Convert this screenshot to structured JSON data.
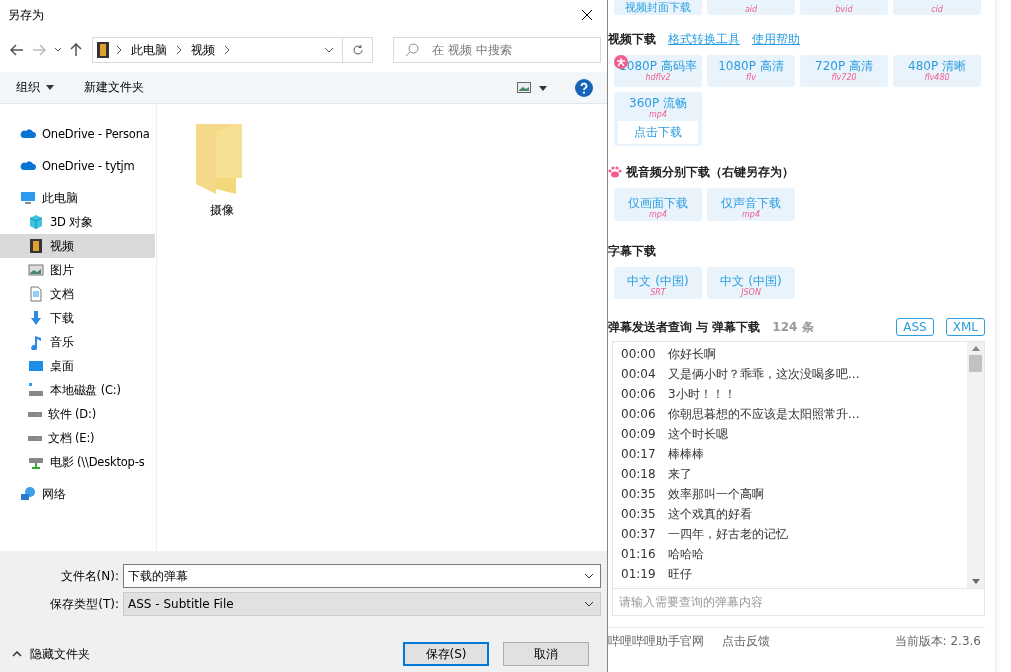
{
  "dialog": {
    "title": "另存为",
    "address": {
      "crumbs": [
        "此电脑",
        "视频"
      ]
    },
    "search": {
      "placeholder": "在 视频 中搜索"
    },
    "toolbar": {
      "organize": "组织",
      "new_folder": "新建文件夹"
    },
    "nav": [
      {
        "label": "OneDrive - Persona",
        "kind": "cloud",
        "selected": false
      },
      {
        "label": "OneDrive - tytjm",
        "kind": "cloud",
        "selected": false
      },
      {
        "label": "此电脑",
        "kind": "pc",
        "selected": false,
        "children": [
          {
            "label": "3D 对象",
            "kind": "cube",
            "selected": false
          },
          {
            "label": "视频",
            "kind": "film",
            "selected": true
          },
          {
            "label": "图片",
            "kind": "picture",
            "selected": false
          },
          {
            "label": "文档",
            "kind": "doc",
            "selected": false
          },
          {
            "label": "下载",
            "kind": "download",
            "selected": false
          },
          {
            "label": "音乐",
            "kind": "music",
            "selected": false
          },
          {
            "label": "桌面",
            "kind": "desktop",
            "selected": false
          },
          {
            "label": "本地磁盘 (C:)",
            "kind": "sysdrive",
            "selected": false
          },
          {
            "label": "软件 (D:)",
            "kind": "drive",
            "selected": false
          },
          {
            "label": "文档 (E:)",
            "kind": "drive",
            "selected": false
          },
          {
            "label": "电影 (\\\\Desktop-s",
            "kind": "netdrive",
            "selected": false
          }
        ]
      },
      {
        "label": "网络",
        "kind": "network",
        "selected": false
      }
    ],
    "files": [
      {
        "name": "摄像"
      }
    ],
    "file_name": {
      "label": "文件名(N):",
      "value": "下载的弹幕"
    },
    "save_type": {
      "label": "保存类型(T):",
      "value": "ASS - Subtitle File"
    },
    "hide_folders": "隐藏文件夹",
    "buttons": [
      {
        "label": "保存(S)",
        "default": true
      },
      {
        "label": "取消",
        "default": false
      }
    ]
  },
  "panel": {
    "top_buttons": [
      {
        "label": "视频封面下载"
      },
      {
        "sub": "aid"
      },
      {
        "sub": "bvid"
      },
      {
        "sub": "cid"
      }
    ],
    "video_heading": "视频下载",
    "links": [
      "格式转换工具",
      "使用帮助"
    ],
    "qualities": [
      {
        "label": "1080P 高码率",
        "sub": "hdflv2",
        "vip": true
      },
      {
        "label": "1080P 高清",
        "sub": "flv",
        "vip": false
      },
      {
        "label": "720P 高清",
        "sub": "flv720",
        "vip": false
      },
      {
        "label": "480P 清晰",
        "sub": "flv480",
        "vip": false
      },
      {
        "label": "360P 流畅",
        "sub": "mp4",
        "vip": false,
        "hover_action": "点击下载"
      }
    ],
    "separate_heading": "视音频分别下载（右键另存为）",
    "separate": [
      {
        "label": "仅画面下载",
        "sub": "mp4"
      },
      {
        "label": "仅声音下载",
        "sub": "mp4"
      }
    ],
    "subtitle_heading": "字幕下载",
    "subtitles": [
      {
        "label": "中文 (中国)",
        "sub": "SRT"
      },
      {
        "label": "中文 (中国)",
        "sub": "JSON"
      }
    ],
    "danmaku_heading": "弹幕发送者查询 与 弹幕下载",
    "danmaku_count": "124 条",
    "formats": [
      "ASS",
      "XML"
    ],
    "danmaku": [
      {
        "time": "00:00",
        "text": "你好长啊"
      },
      {
        "time": "00:04",
        "text": "又是俩小时？乖乖，这次没喝多吧..."
      },
      {
        "time": "00:06",
        "text": "3小时！！！"
      },
      {
        "time": "00:06",
        "text": "你朝思暮想的不应该是太阳照常升..."
      },
      {
        "time": "00:09",
        "text": "这个时长嗯"
      },
      {
        "time": "00:17",
        "text": "棒棒棒"
      },
      {
        "time": "00:18",
        "text": "来了"
      },
      {
        "time": "00:35",
        "text": "效率那叫一个高啊"
      },
      {
        "time": "00:35",
        "text": "这个戏真的好看"
      },
      {
        "time": "00:37",
        "text": "一四年，好古老的记忆"
      },
      {
        "time": "01:16",
        "text": "哈哈哈"
      },
      {
        "time": "01:19",
        "text": "旺仔"
      }
    ],
    "query": {
      "placeholder": "请输入需要查询的弹幕内容"
    },
    "footer": {
      "links": [
        "哔哩哔哩助手官网",
        "点击反馈"
      ],
      "version": "当前版本: 2.3.6"
    }
  }
}
